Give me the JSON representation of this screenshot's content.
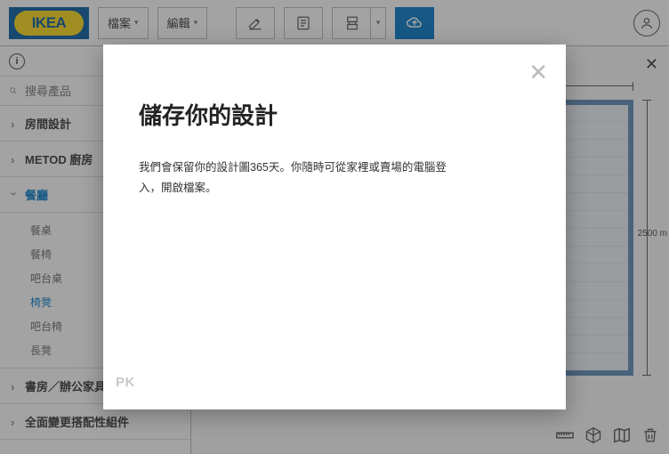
{
  "logo_text": "IKEA",
  "header": {
    "file_menu": "檔案",
    "edit_menu": "編輯"
  },
  "search": {
    "placeholder": "搜尋產品"
  },
  "categories": [
    {
      "label": "房間設計",
      "expanded": false
    },
    {
      "label": "METOD 廚房",
      "expanded": false
    },
    {
      "label": "餐廳",
      "expanded": true,
      "items": [
        {
          "label": "餐桌",
          "active": false
        },
        {
          "label": "餐椅",
          "active": false
        },
        {
          "label": "吧台桌",
          "active": false
        },
        {
          "label": "椅凳",
          "active": true
        },
        {
          "label": "吧台椅",
          "active": false
        },
        {
          "label": "長凳",
          "active": false
        }
      ]
    },
    {
      "label": "書房／辦公家具",
      "expanded": false
    },
    {
      "label": "全面變更搭配性組件",
      "expanded": false
    }
  ],
  "canvas": {
    "height_label": "2500 m"
  },
  "modal": {
    "title": "儲存你的設計",
    "body": "我們會保留你的設計圖365天。你隨時可從家裡或賣場的電腦登入，開啟檔案。"
  },
  "watermark": "PK"
}
